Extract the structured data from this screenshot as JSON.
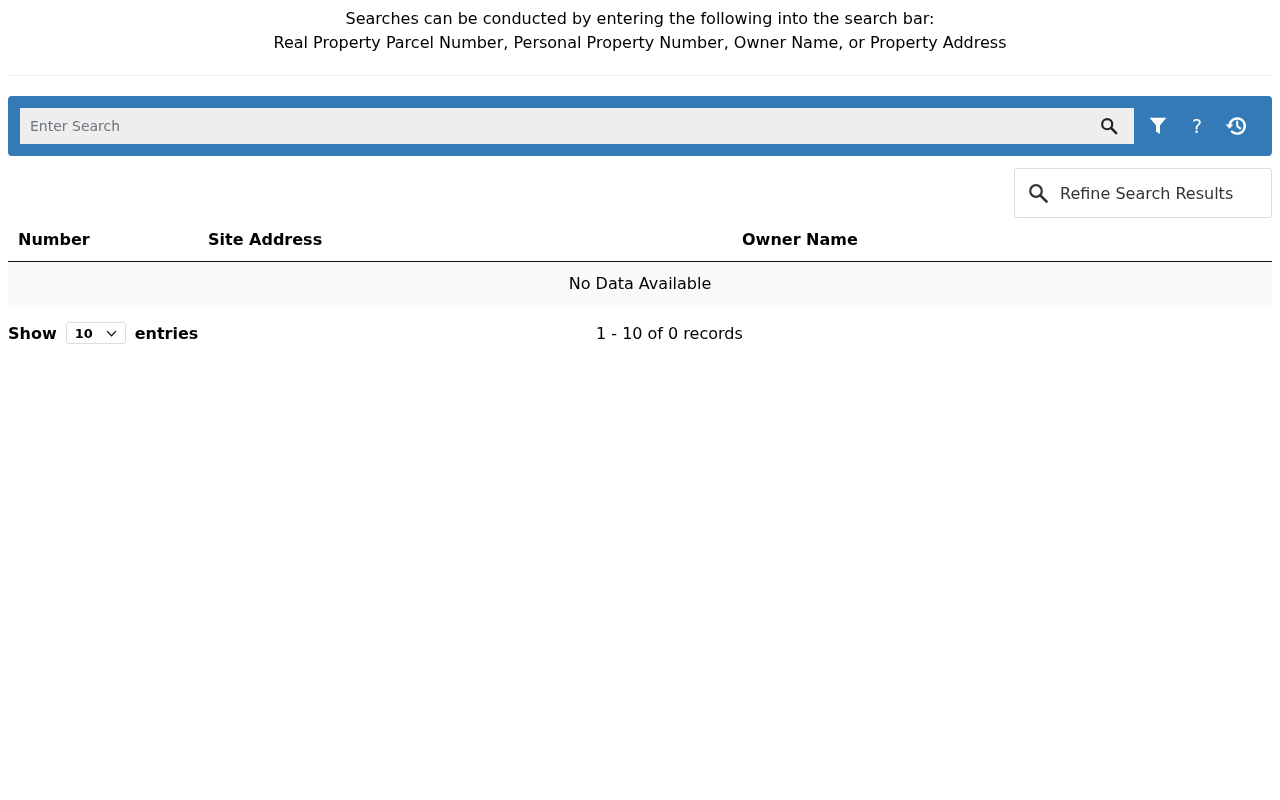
{
  "intro": {
    "lines": [
      "Searches can be conducted by entering the following into the search bar:",
      "Real Property Parcel Number, Personal Property Number, Owner Name, or Property Address"
    ]
  },
  "search_bar": {
    "placeholder": "Enter Search",
    "help_label": "?"
  },
  "refine_button": {
    "label": "Refine Search Results"
  },
  "table": {
    "columns": [
      "Number",
      "Site Address",
      "Owner Name"
    ],
    "empty_message": "No Data Available"
  },
  "footer": {
    "show_label": "Show",
    "page_size": "10",
    "entries_label": "entries",
    "record_info": "1 - 10 of 0 records"
  }
}
